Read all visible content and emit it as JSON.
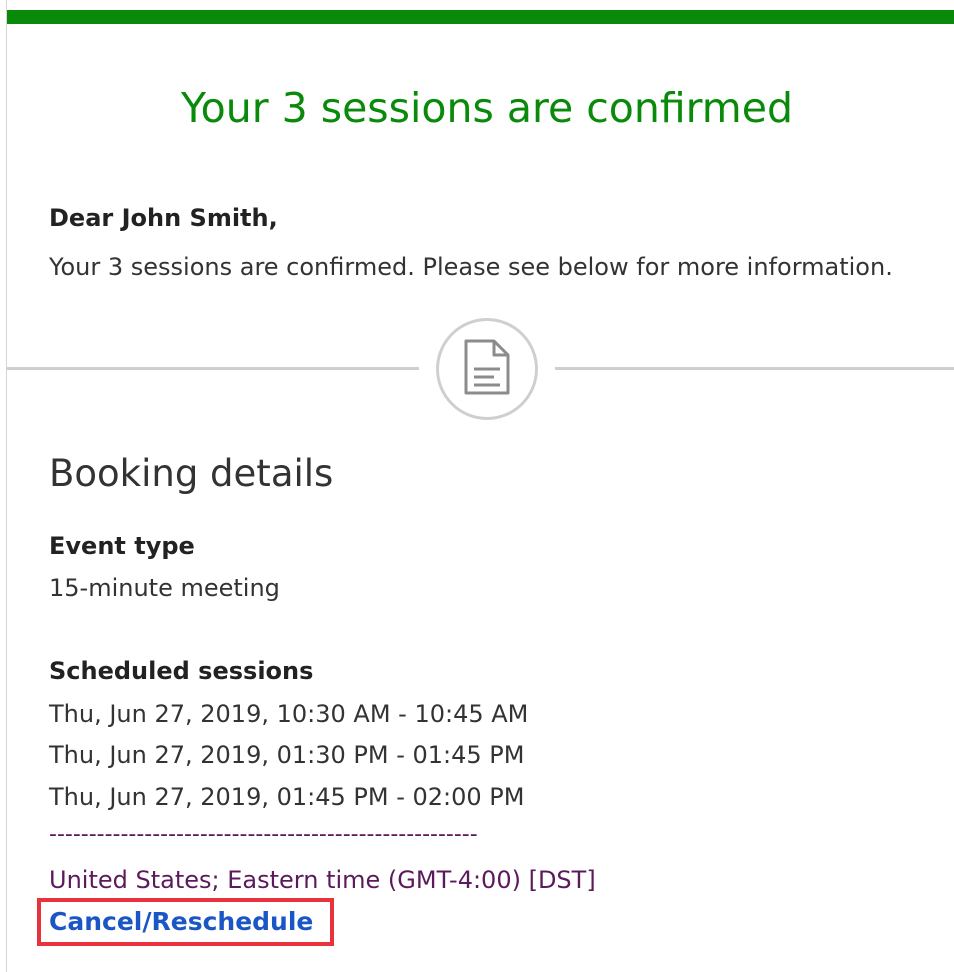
{
  "header": {
    "accent_color": "#0a8a0a",
    "headline": "Your 3 sessions are confirmed"
  },
  "message": {
    "greeting": "Dear John Smith,",
    "intro": "Your 3 sessions are confirmed. Please see below for more information."
  },
  "divider": {
    "icon": "document-icon"
  },
  "booking": {
    "title": "Booking details",
    "event_type_label": "Event type",
    "event_type_value": "15-minute meeting",
    "sessions_label": "Scheduled sessions",
    "sessions": [
      "Thu, Jun 27, 2019, 10:30 AM - 10:45 AM",
      "Thu, Jun 27, 2019, 01:30 PM - 01:45 PM",
      "Thu, Jun 27, 2019, 01:45 PM - 02:00 PM"
    ],
    "separator": "------------------------------------------------------",
    "timezone": "United States; Eastern time (GMT-4:00) [DST]",
    "cancel_link": "Cancel/Reschedule",
    "highlight_color": "#e8323c",
    "link_color": "#1a56c6"
  }
}
